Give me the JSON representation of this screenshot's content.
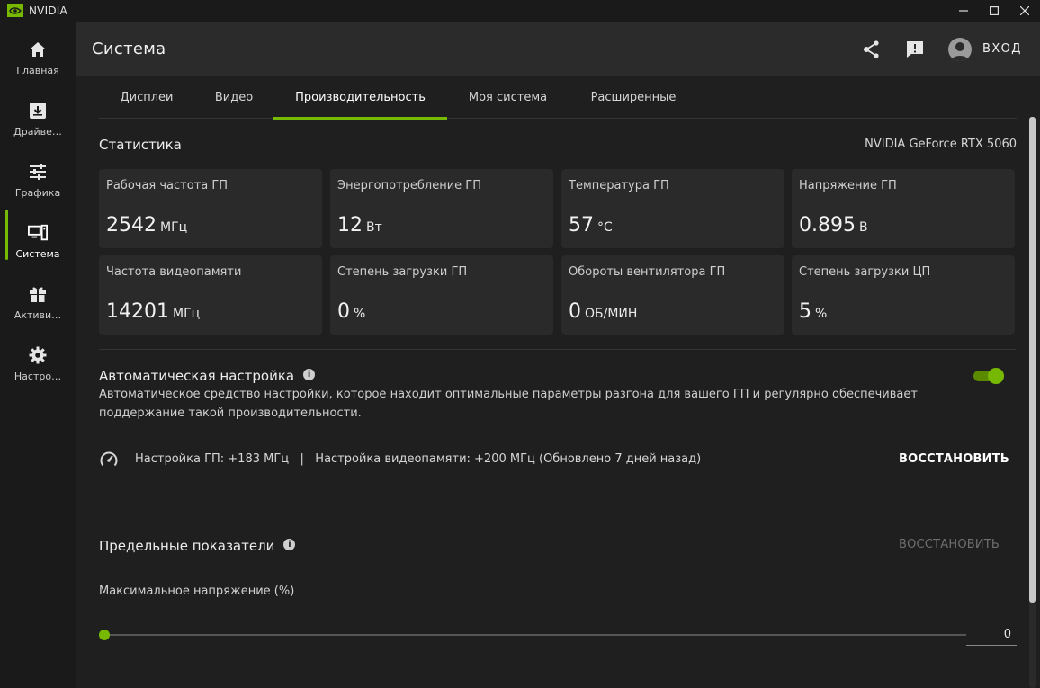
{
  "window": {
    "app_name": "NVIDIA",
    "controls": [
      "–",
      "☐",
      "✕"
    ]
  },
  "sidebar": {
    "items": [
      {
        "label": "Главная",
        "icon": "home-icon"
      },
      {
        "label": "Драйве…",
        "icon": "driver-download-icon"
      },
      {
        "label": "Графика",
        "icon": "sliders-icon"
      },
      {
        "label": "Система",
        "icon": "system-icon",
        "active": true
      },
      {
        "label": "Активи…",
        "icon": "gift-icon"
      },
      {
        "label": "Настро…",
        "icon": "gear-icon"
      }
    ]
  },
  "header": {
    "title": "Система",
    "login_label": "ВХОД"
  },
  "tabs": [
    {
      "label": "Дисплеи"
    },
    {
      "label": "Видео"
    },
    {
      "label": "Производительность",
      "active": true
    },
    {
      "label": "Моя система"
    },
    {
      "label": "Расширенные"
    }
  ],
  "stats": {
    "title": "Статистика",
    "gpu_name": "NVIDIA GeForce RTX 5060",
    "cards": [
      {
        "label": "Рабочая частота ГП",
        "value": "2542",
        "unit": "МГц"
      },
      {
        "label": "Энергопотребление ГП",
        "value": "12",
        "unit": "Вт"
      },
      {
        "label": "Температура ГП",
        "value": "57",
        "unit": "°C"
      },
      {
        "label": "Напряжение ГП",
        "value": "0.895",
        "unit": "В"
      },
      {
        "label": "Частота видеопамяти",
        "value": "14201",
        "unit": "МГц"
      },
      {
        "label": "Степень загрузки ГП",
        "value": "0",
        "unit": "%"
      },
      {
        "label": "Обороты вентилятора ГП",
        "value": "0",
        "unit": "ОБ/МИН"
      },
      {
        "label": "Степень загрузки ЦП",
        "value": "5",
        "unit": "%"
      }
    ]
  },
  "auto_tune": {
    "title": "Автоматическая настройка",
    "description": "Автоматическое средство настройки, которое находит оптимальные параметры разгона для вашего ГП и регулярно обеспечивает поддержание такой производительности.",
    "enabled": true,
    "status_text": "Настройка ГП: +183 МГц   |   Настройка видеопамяти: +200 МГц (Обновлено 7 дней назад)",
    "restore_label": "ВОССТАНОВИТЬ"
  },
  "limits": {
    "title": "Предельные показатели",
    "restore_label": "ВОССТАНОВИТЬ",
    "max_voltage_label": "Максимальное напряжение (%)",
    "max_voltage_value": "0",
    "max_voltage_fraction": 0
  },
  "colors": {
    "accent": "#76b900",
    "background": "#1f1f1f",
    "card": "#2a2a2a",
    "header": "#2b2b2b"
  }
}
